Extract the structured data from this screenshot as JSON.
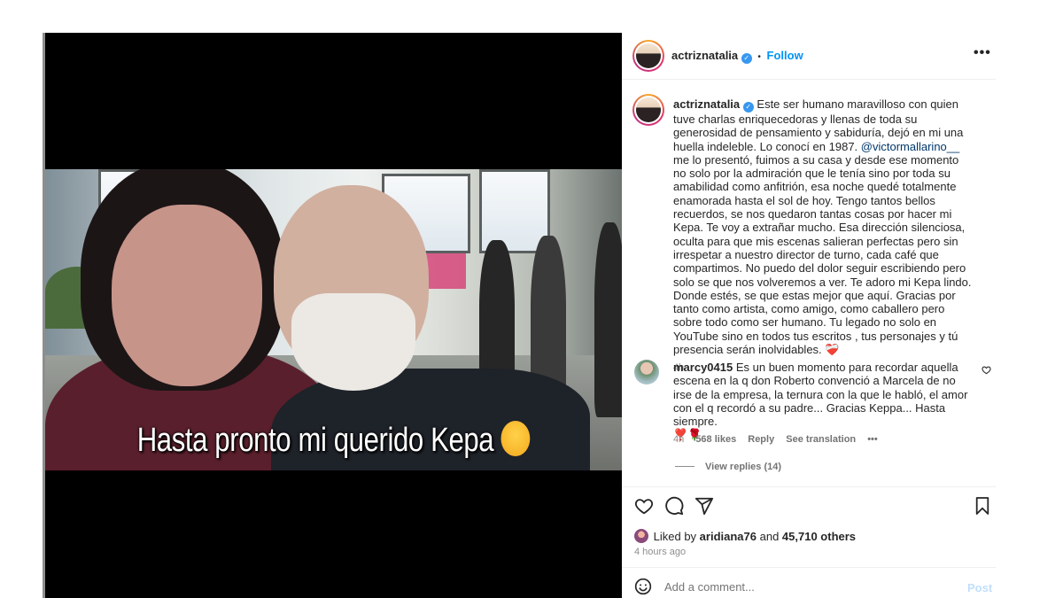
{
  "post": {
    "username": "actriznatalia",
    "follow_label": "Follow",
    "separator": "•",
    "more_label": "•••",
    "caption_overlay": "Hasta pronto mi querido Kepa",
    "body_part1": " Este ser humano maravilloso con quien tuve charlas enriquecedoras y llenas de toda su generosidad de pensamiento y sabiduría, dejó en mi una huella indeleble. Lo conocí en 1987. ",
    "mention": "@victormallarino__",
    "body_part2": " me lo presentó, fuimos a su casa y desde ese momento no solo por la admiración que le tenía sino por toda su amabilidad como anfitrión, esa noche quedé totalmente enamorada hasta el sol de hoy. Tengo tantos bellos recuerdos, se nos quedaron tantas cosas por hacer mi Kepa. Te voy a extrañar mucho. Esa dirección silenciosa, oculta para que mis escenas salieran perfectas pero sin irrespetar a nuestro director de turno, cada café que compartimos. No puedo del dolor seguir escribiendo pero solo se que nos volveremos a ver. Te adoro mi Kepa lindo. Donde estés, se que estas mejor que aquí. Gracias por tanto como artista, como amigo, como caballero pero sobre todo como ser humano. Tu legado no solo en YouTube sino en todos tus escritos , tus personajes y tú presencia serán inolvidables. ",
    "body_emoji": "❤️‍🩹",
    "time": "4h"
  },
  "comment": {
    "username": "marcy0415",
    "text": " Es un buen momento para recordar aquella escena en la q don Roberto convenció a Marcela de no irse de la empresa, la ternura con la que le habló, el amor con el q recordó a su padre... Gracias Keppa... Hasta siempre.",
    "emoji": "❣️🌹",
    "time": "4h",
    "likes": "568 likes",
    "reply_label": "Reply",
    "translate_label": "See translation",
    "more_label": "•••",
    "view_replies": "View replies (14)"
  },
  "likes": {
    "prefix": "Liked by ",
    "user": "aridiana76",
    "middle": " and ",
    "others": "45,710 others"
  },
  "time_ago": "4 hours ago",
  "add_comment": {
    "placeholder": "Add a comment...",
    "post_label": "Post"
  },
  "icons": [
    "heart-icon",
    "comment-icon",
    "share-icon",
    "bookmark-icon",
    "emoji-icon",
    "verified-icon",
    "more-icon"
  ],
  "colors": {
    "link_blue": "#0095f6",
    "verified_blue": "#3897f0",
    "mention_blue": "#00376b",
    "muted": "#8e8e8e",
    "post_disabled": "#c0dffd"
  }
}
